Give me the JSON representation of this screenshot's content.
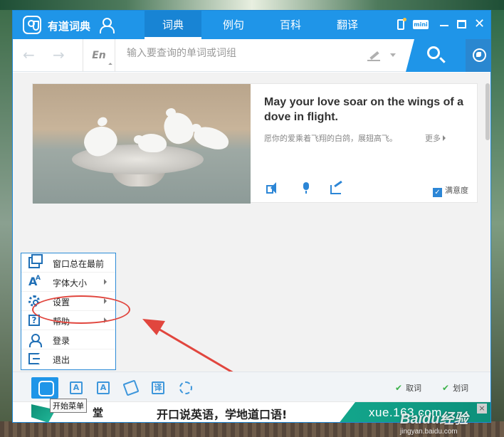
{
  "titlebar": {
    "app_name": "有道词典",
    "tabs": [
      {
        "label": "词典",
        "active": true
      },
      {
        "label": "例句",
        "active": false
      },
      {
        "label": "百科",
        "active": false
      },
      {
        "label": "翻译",
        "active": false
      }
    ],
    "mini_label": "mini",
    "accent_color": "#1f95e8"
  },
  "searchbar": {
    "lang_label": "En",
    "placeholder": "输入要查询的单词或词组"
  },
  "daily_card": {
    "quote_en": "May your love soar on the wings of a dove in flight.",
    "quote_cn": "愿你的爱乘着飞翔的白鸽，展翅高飞。",
    "more_label": "更多",
    "satisfaction_label": "满意度",
    "satisfaction_checked": true
  },
  "context_menu": {
    "items": [
      {
        "label": "窗口总在最前",
        "icon": "window-icon",
        "has_submenu": false
      },
      {
        "label": "字体大小",
        "icon": "font-size-icon",
        "has_submenu": true
      },
      {
        "label": "设置",
        "icon": "gear-icon",
        "has_submenu": true
      },
      {
        "label": "帮助",
        "icon": "help-icon",
        "has_submenu": true
      },
      {
        "label": "登录",
        "icon": "user-icon",
        "has_submenu": false
      },
      {
        "label": "退出",
        "icon": "exit-icon",
        "has_submenu": false
      }
    ],
    "highlight_color": "#e1463e"
  },
  "bottombar": {
    "tooltip": "开始菜单",
    "toggle_1": "取词",
    "toggle_2": "划词"
  },
  "ad": {
    "left_text": "堂",
    "main_text": "开口说英语，学地道口语!",
    "url_text": "xue.163.com",
    "close_label": "×"
  },
  "watermark": {
    "brand": "Baidu经验",
    "site": "jingyan.baidu.com"
  }
}
